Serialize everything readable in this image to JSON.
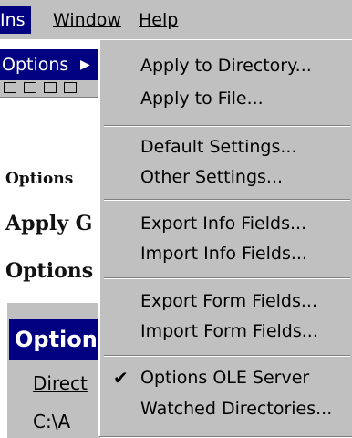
{
  "menubar": {
    "items": [
      {
        "label": "Ins"
      },
      {
        "label": "Window"
      },
      {
        "label": "Help"
      }
    ]
  },
  "background": {
    "options_row_label": "Options",
    "options_arrow": "▶",
    "bold_labels": [
      "Options",
      "Apply G",
      "Options"
    ],
    "panel_title": "Option",
    "panel_directory_label": "Direct",
    "panel_path": "C:\\A"
  },
  "dropdown": {
    "groups": [
      {
        "items": [
          {
            "label": "Apply to Directory...",
            "checked": false
          },
          {
            "label": "Apply to File...",
            "checked": false
          }
        ]
      },
      {
        "items": [
          {
            "label": "Default Settings...",
            "checked": false
          },
          {
            "label": "Other Settings...",
            "checked": false
          }
        ]
      },
      {
        "items": [
          {
            "label": "Export Info Fields...",
            "checked": false
          },
          {
            "label": "Import Info Fields...",
            "checked": false
          }
        ]
      },
      {
        "items": [
          {
            "label": "Export Form Fields...",
            "checked": false
          },
          {
            "label": "Import Form Fields...",
            "checked": false
          }
        ]
      },
      {
        "items": [
          {
            "label": "Options OLE Server",
            "checked": true,
            "check_mark": "✔"
          },
          {
            "label": "Watched Directories...",
            "checked": false
          }
        ]
      }
    ]
  },
  "colors": {
    "menu_face": "#c0c0c0",
    "highlight": "#000080",
    "highlight_text": "#ffffff"
  }
}
